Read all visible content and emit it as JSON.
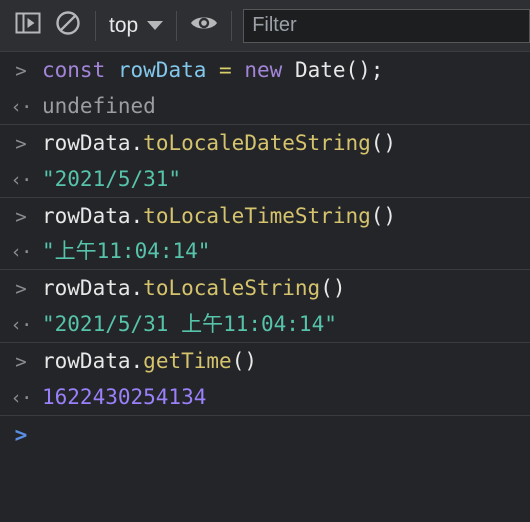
{
  "toolbar": {
    "sidebar_toggle": {
      "icon": "console-sidebar-toggle-icon",
      "title": "Show console sidebar"
    },
    "clear_console": {
      "icon": "clear-console-icon",
      "title": "Clear console"
    },
    "context_selector": {
      "value": "top",
      "chevron": "chevron-down-icon"
    },
    "live_expression": {
      "icon": "eye-icon",
      "title": "Create live expression"
    },
    "filter": {
      "value": "",
      "placeholder": "Filter"
    }
  },
  "console": {
    "groups": [
      {
        "input_marker": ">",
        "output_marker": "‹·",
        "input_tokens": [
          {
            "text": "const",
            "cls": "t-keyword"
          },
          {
            "text": " ",
            "cls": "t-plain"
          },
          {
            "text": "rowData",
            "cls": "t-var"
          },
          {
            "text": " ",
            "cls": "t-plain"
          },
          {
            "text": "=",
            "cls": "t-op"
          },
          {
            "text": " ",
            "cls": "t-plain"
          },
          {
            "text": "new",
            "cls": "t-keyword"
          },
          {
            "text": " ",
            "cls": "t-plain"
          },
          {
            "text": "Date();",
            "cls": "t-plain"
          }
        ],
        "input_text": "const rowData = new Date();",
        "output_tokens": [
          {
            "text": "undefined",
            "cls": "t-undef"
          }
        ],
        "output_text": "undefined"
      },
      {
        "input_marker": ">",
        "output_marker": "‹·",
        "input_tokens": [
          {
            "text": "rowData",
            "cls": "t-plain"
          },
          {
            "text": ".",
            "cls": "t-punct"
          },
          {
            "text": "toLocaleDateString",
            "cls": "t-method"
          },
          {
            "text": "()",
            "cls": "t-punct"
          }
        ],
        "input_text": "rowData.toLocaleDateString()",
        "output_tokens": [
          {
            "text": "\"2021/5/31\"",
            "cls": "t-string"
          }
        ],
        "output_text": "\"2021/5/31\""
      },
      {
        "input_marker": ">",
        "output_marker": "‹·",
        "input_tokens": [
          {
            "text": "rowData",
            "cls": "t-plain"
          },
          {
            "text": ".",
            "cls": "t-punct"
          },
          {
            "text": "toLocaleTimeString",
            "cls": "t-method"
          },
          {
            "text": "()",
            "cls": "t-punct"
          }
        ],
        "input_text": "rowData.toLocaleTimeString()",
        "output_tokens": [
          {
            "text": "\"上午11:04:14\"",
            "cls": "t-string"
          }
        ],
        "output_text": "\"上午11:04:14\""
      },
      {
        "input_marker": ">",
        "output_marker": "‹·",
        "input_tokens": [
          {
            "text": "rowData",
            "cls": "t-plain"
          },
          {
            "text": ".",
            "cls": "t-punct"
          },
          {
            "text": "toLocaleString",
            "cls": "t-method"
          },
          {
            "text": "()",
            "cls": "t-punct"
          }
        ],
        "input_text": "rowData.toLocaleString()",
        "output_tokens": [
          {
            "text": "\"2021/5/31 上午11:04:14\"",
            "cls": "t-string"
          }
        ],
        "output_text": "\"2021/5/31 上午11:04:14\""
      },
      {
        "input_marker": ">",
        "output_marker": "‹·",
        "input_tokens": [
          {
            "text": "rowData",
            "cls": "t-plain"
          },
          {
            "text": ".",
            "cls": "t-punct"
          },
          {
            "text": "getTime",
            "cls": "t-method"
          },
          {
            "text": "()",
            "cls": "t-punct"
          }
        ],
        "input_text": "rowData.getTime()",
        "output_tokens": [
          {
            "text": "1622430254134",
            "cls": "t-number"
          }
        ],
        "output_text": "1622430254134"
      }
    ],
    "prompt": {
      "caret": ">",
      "value": ""
    }
  },
  "colors": {
    "background": "#242528",
    "toolbar_background": "#2e2f33",
    "separator": "#3a3b3e",
    "keyword": "#a285d8",
    "variable": "#82c7ec",
    "operator": "#d9d06a",
    "method": "#d5c46d",
    "string": "#56c4ab",
    "number": "#9a80fa",
    "undefined": "#9b9da0",
    "prompt_caret": "#5a8fe6",
    "text": "#e3e3e3"
  }
}
